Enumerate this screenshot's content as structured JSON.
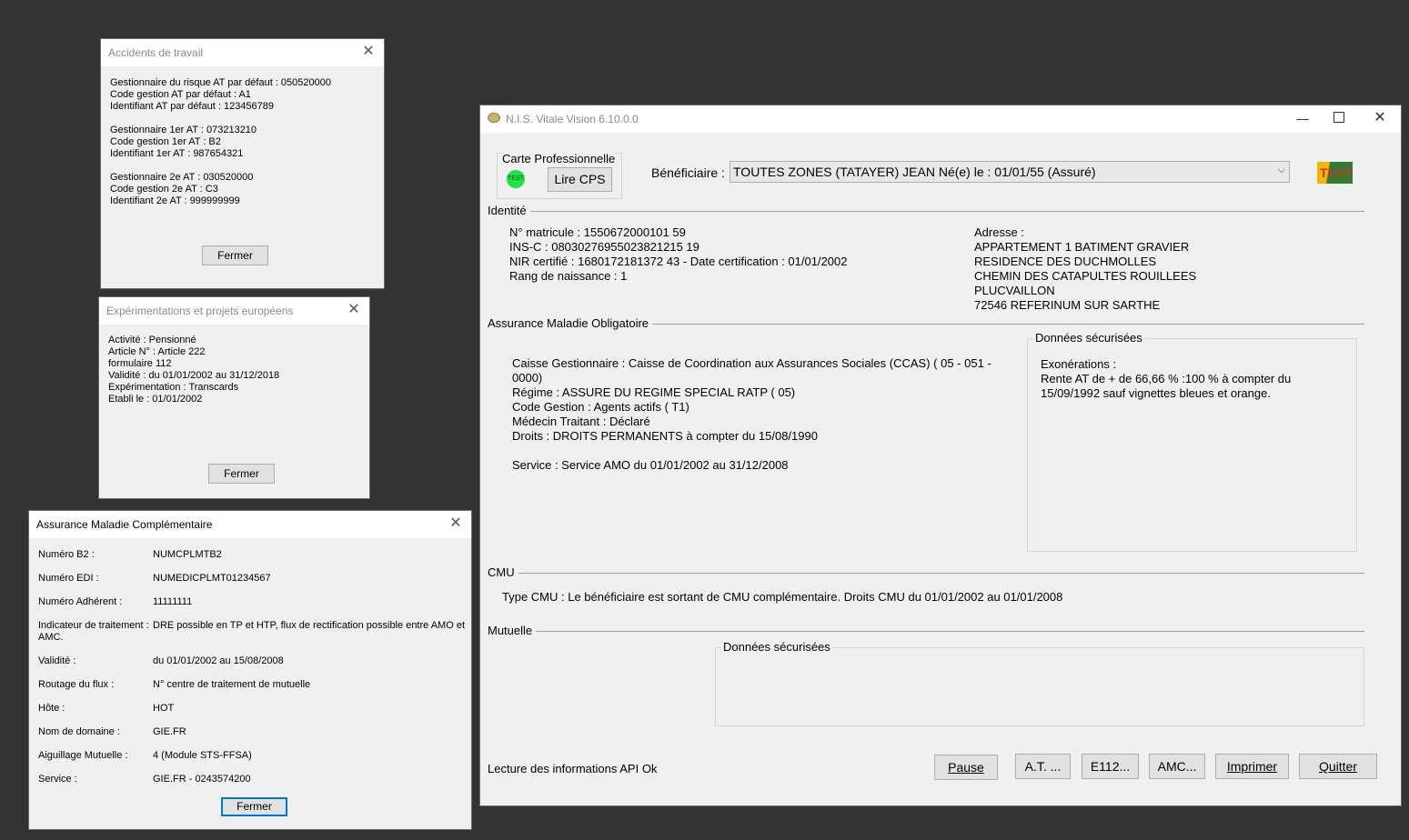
{
  "at_window": {
    "title": "Accidents de travail",
    "lines": [
      "Gestionnaire du risque AT par défaut : 050520000",
      "Code gestion AT par défaut : A1",
      "Identifiant AT par défaut : 123456789",
      "",
      "Gestionnaire 1er AT : 073213210",
      "Code gestion 1er AT : B2",
      "Identifiant 1er AT : 987654321",
      "",
      "Gestionnaire 2e AT : 030520000",
      "Code gestion 2e AT : C3",
      "Identifiant 2e AT : 999999999"
    ],
    "close_label": "Fermer"
  },
  "exp_window": {
    "title": "Expérimentations et projets européens",
    "lines": [
      "Activité : Pensionné",
      "Article N° : Article 222",
      "formulaire 112",
      "Validité : du 01/01/2002 au 31/12/2018",
      "Expérimentation : Transcards",
      "Etabli le : 01/01/2002"
    ],
    "close_label": "Fermer"
  },
  "amc_window": {
    "title": "Assurance Maladie Complémentaire",
    "rows": [
      {
        "label": "Numéro B2 :",
        "value": "NUMCPLMTB2"
      },
      {
        "label": "Numéro EDI :",
        "value": "NUMEDICPLMT01234567"
      },
      {
        "label": "Numéro Adhérent :",
        "value": "11111111"
      },
      {
        "label": "Indicateur de traitement :",
        "value": "DRE possible en TP et HTP, flux de rectification possible entre AMO et",
        "value2": "AMC."
      },
      {
        "label": "Validité :",
        "value": "du 01/01/2002 au 15/08/2008"
      },
      {
        "label": "Routage du flux :",
        "value": "N° centre de traitement de mutuelle"
      },
      {
        "label": "Hôte :",
        "value": "HOT"
      },
      {
        "label": "Nom de domaine :",
        "value": "GIE.FR"
      },
      {
        "label": "Aiguillage Mutuelle :",
        "value": "4 (Module STS-FFSA)"
      },
      {
        "label": "Service :",
        "value": "GIE.FR - 0243574200"
      }
    ],
    "close_label": "Fermer"
  },
  "main_window": {
    "title": "N.I.S. Vitale Vision 6.10.0.0",
    "carte_pro": {
      "title": "Carte Professionnelle",
      "badge": "TEST",
      "button": "Lire CPS"
    },
    "beneficiaire": {
      "label": "Bénéficiaire :",
      "value": "TOUTES ZONES (TATAYER)  JEAN Né(e) le : 01/01/55 (Assuré)"
    },
    "test_logo": "TEST",
    "identite": {
      "title": "Identité",
      "lines": [
        "N° matricule : 1550672000101 59",
        "INS-C : 08030276955023821215 19",
        "NIR certifié : 1680172181372 43 - Date certification : 01/01/2002",
        "Rang de naissance : 1"
      ],
      "address": [
        "Adresse :",
        "APPARTEMENT 1 BATIMENT GRAVIER",
        "RESIDENCE DES DUCHMOLLES",
        "CHEMIN DES CATAPULTES ROUILLEES",
        "PLUCVAILLON",
        "72546 REFERINUM SUR SARTHE"
      ]
    },
    "amo": {
      "title": "Assurance Maladie Obligatoire",
      "lines": [
        "Caisse Gestionnaire : Caisse de Coordination aux Assurances Sociales (CCAS) ( 05 - 051 -",
        "0000)",
        "Régime : ASSURE DU REGIME SPECIAL RATP ( 05)",
        "Code Gestion : Agents actifs ( T1)",
        "Médecin Traitant : Déclaré",
        "Droits : DROITS PERMANENTS à compter du 15/08/1990",
        "",
        "Service : Service AMO du 01/01/2002 au 31/12/2008"
      ],
      "secured": {
        "title": "Données sécurisées",
        "lines": [
          "Exonérations :",
          "Rente AT de + de 66,66 % :100 % à compter du",
          "15/09/1992 sauf vignettes bleues et orange."
        ]
      }
    },
    "cmu": {
      "title": "CMU",
      "text": "Type CMU : Le bénéficiaire est sortant de CMU complémentaire. Droits CMU du 01/01/2002 au 01/01/2008"
    },
    "mutuelle": {
      "title": "Mutuelle",
      "secured_title": "Données sécurisées"
    },
    "status": "Lecture des informations API Ok",
    "buttons": {
      "pause": "Pause",
      "at": "A.T. ...",
      "e112": "E112...",
      "amc": "AMC...",
      "imprimer": "Imprimer",
      "quitter": "Quitter"
    }
  }
}
